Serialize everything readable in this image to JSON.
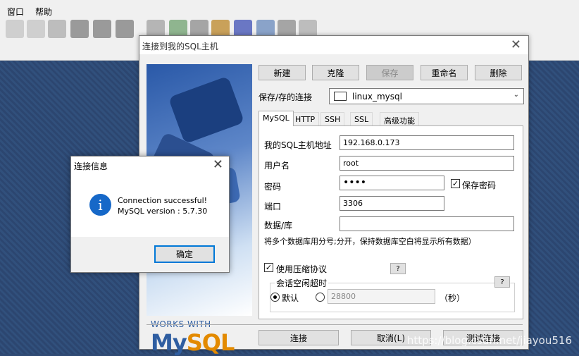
{
  "menubar": {
    "items": [
      "窗口",
      "帮助"
    ]
  },
  "dialog": {
    "title": "连接到我的SQL主机",
    "toolbar_buttons": [
      "新建",
      "克隆",
      "保存",
      "重命名",
      "删除"
    ],
    "saved_connection_label": "保存/存的连接",
    "saved_connection_value": "linux_mysql",
    "tabs": [
      "MySQL",
      "HTTP",
      "SSH",
      "SSL",
      "高级功能"
    ],
    "fields": {
      "host_label": "我的SQL主机地址",
      "host_value": "192.168.0.173",
      "user_label": "用户名",
      "user_value": "root",
      "password_label": "密码",
      "password_value": "••••",
      "save_password_label": "保存密码",
      "port_label": "端口",
      "port_value": "3306",
      "database_label": "数据/库",
      "database_value": "",
      "database_hint": "将多个数据库用分号;分开，保持数据库空白将显示所有数据）",
      "compression_label": "使用压缩协议",
      "help_label": "?",
      "session_timeout_label": "会话空闲超时",
      "default_label": "默认",
      "timeout_value": "28800",
      "seconds_label": "（秒）"
    },
    "footer_buttons": [
      "连接",
      "取消(L)",
      "测试连接"
    ],
    "logo_works": "WORKS WITH",
    "logo_my": "My",
    "logo_sql": "SQL"
  },
  "popup": {
    "title": "连接信息",
    "message_line1": "Connection successful!",
    "message_line2": "MySQL version : 5.7.30",
    "ok_label": "确定"
  },
  "watermark": "https://blog.csdn.net/jiayou516"
}
